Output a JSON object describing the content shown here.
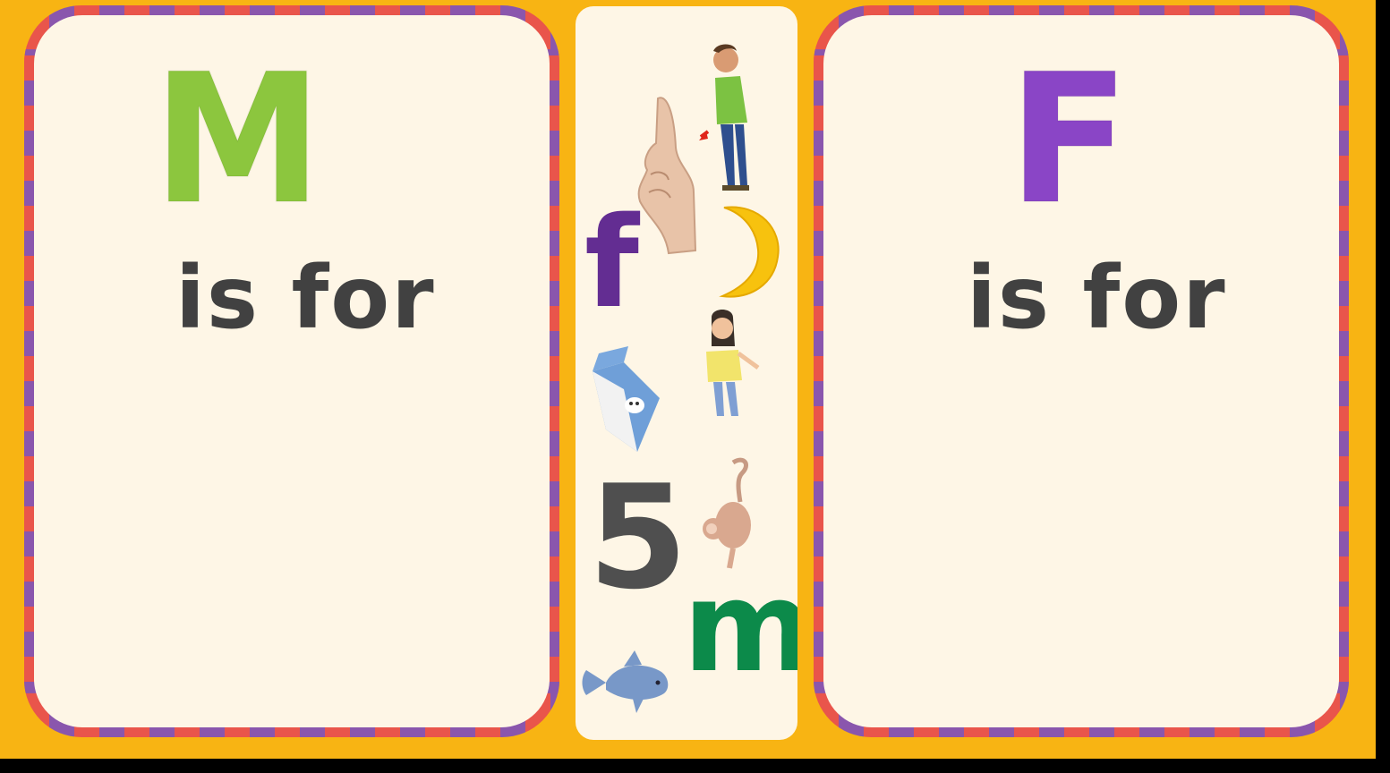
{
  "left_card": {
    "letter": "M",
    "caption": "is for",
    "letter_color": "#8cc63e"
  },
  "right_card": {
    "letter": "F",
    "caption": "is for",
    "letter_color": "#8a45c6"
  },
  "picture_strip": {
    "items": [
      {
        "name": "finger-icon"
      },
      {
        "name": "man-pointing-icon"
      },
      {
        "name": "letter-f-tile",
        "text": "f",
        "color": "#632d92"
      },
      {
        "name": "moon-icon"
      },
      {
        "name": "milk-carton-icon"
      },
      {
        "name": "girl-icon"
      },
      {
        "name": "number-5-tile",
        "text": "5",
        "color": "#4f4f4f"
      },
      {
        "name": "monkey-icon"
      },
      {
        "name": "letter-m-tile",
        "text": "m",
        "color": "#0c8a4a"
      },
      {
        "name": "fish-icon"
      }
    ]
  },
  "colors": {
    "background": "#f8b413",
    "card": "#fef6e6",
    "border_red": "#e9554b",
    "border_purple": "#8a56ad"
  }
}
